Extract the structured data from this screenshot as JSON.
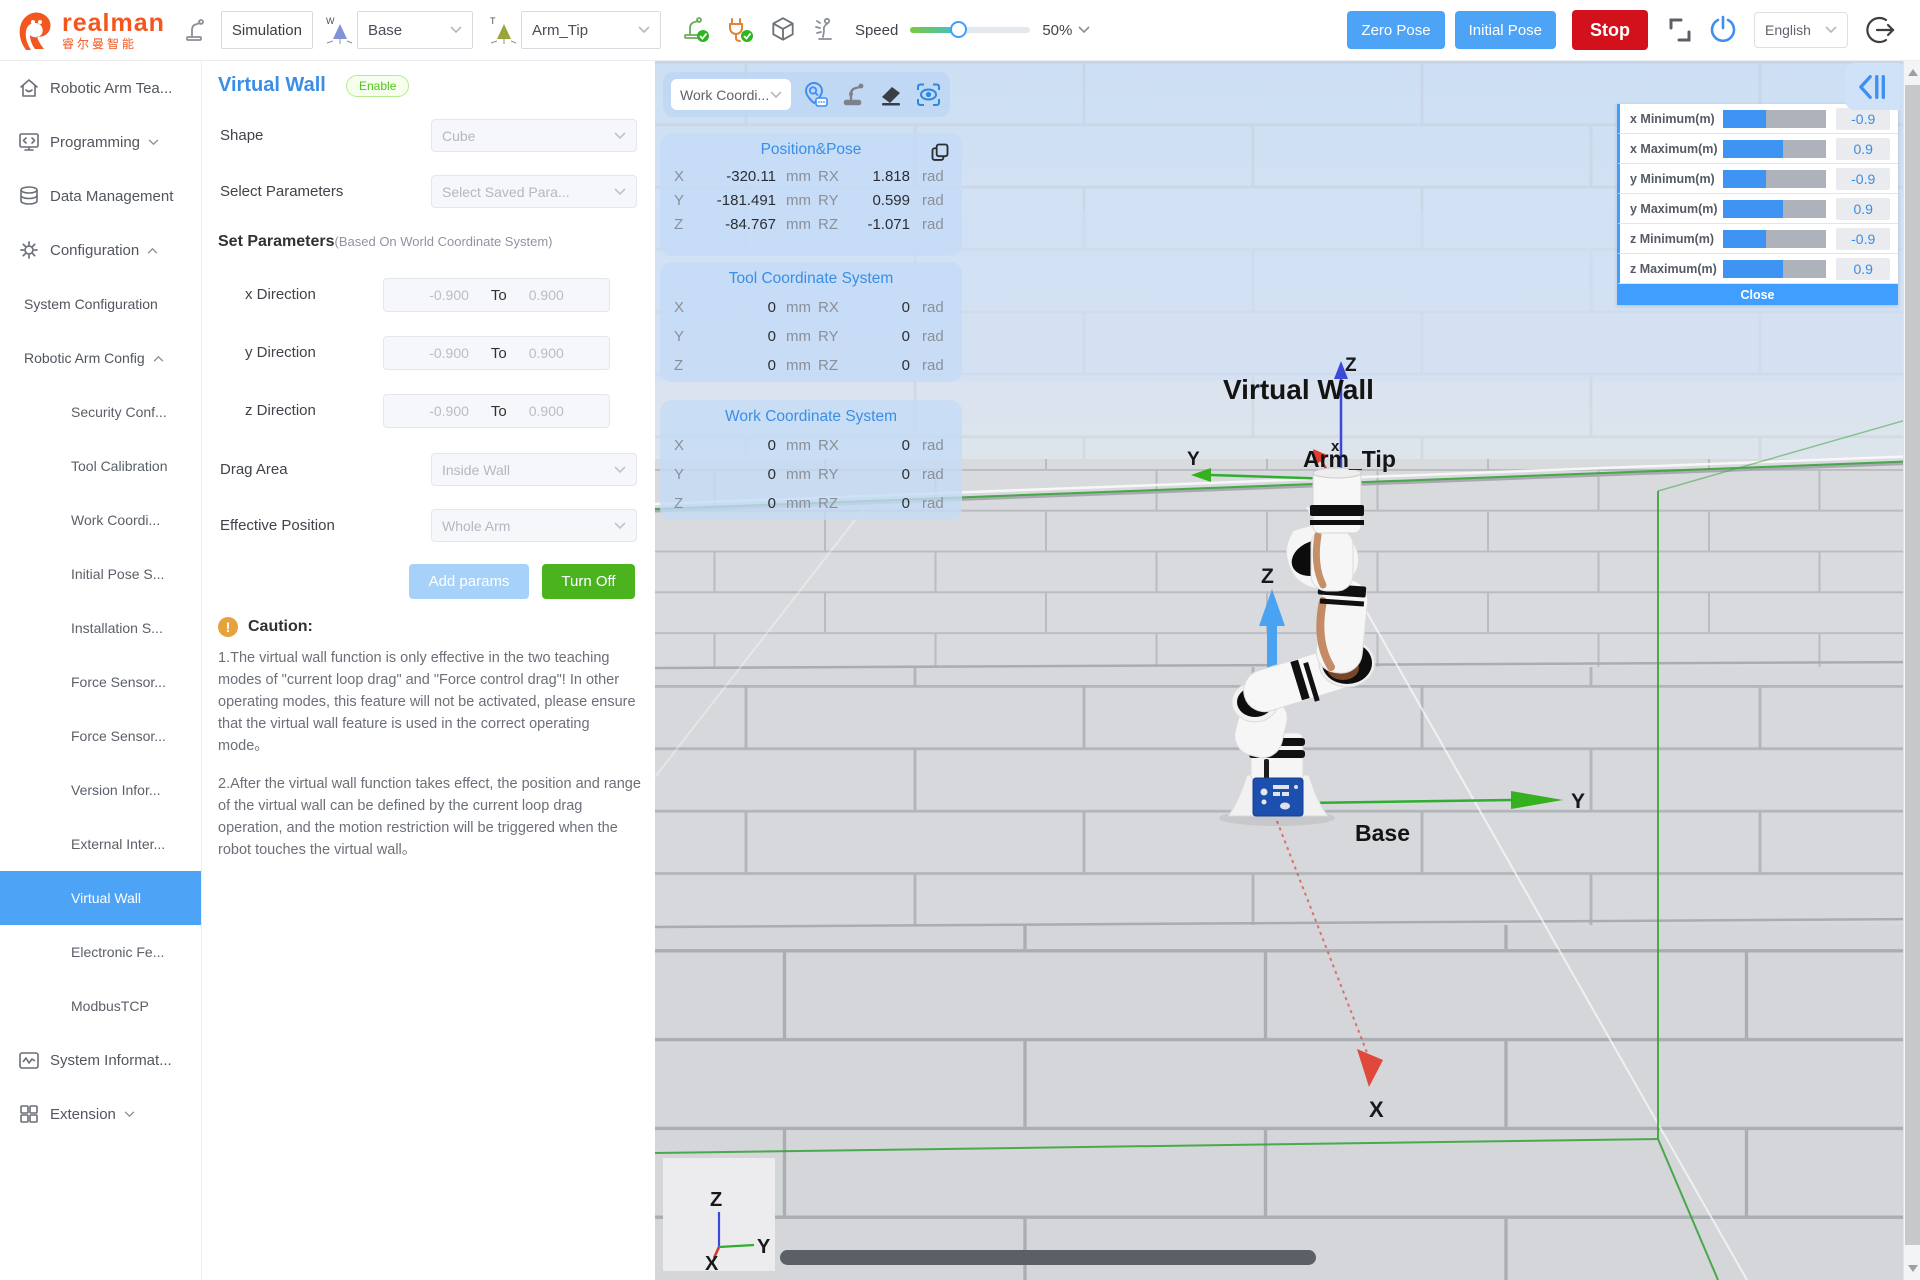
{
  "colors": {
    "accent": "#409eff",
    "button_blue": "#4da3f5",
    "stop_red": "#d3111c",
    "green": "#4bb31e",
    "badge_green": "#52c41a",
    "brand_orange": "#f3571f",
    "panel_blue": "rgba(196,219,246,0.8)"
  },
  "topbar": {
    "brand_name": "realman",
    "brand_cn": "睿尔曼智能",
    "mode_box": "Simulation",
    "world_label": "W",
    "world_value": "Base",
    "tool_label": "T",
    "tool_value": "Arm_Tip",
    "speed_label": "Speed",
    "speed_value": "50%",
    "zero_pose": "Zero Pose",
    "initial_pose": "Initial Pose",
    "stop": "Stop",
    "language": "English"
  },
  "sidebar": {
    "items": [
      {
        "label": "Robotic Arm Tea...",
        "level": 1
      },
      {
        "label": "Programming",
        "level": 1
      },
      {
        "label": "Data Management",
        "level": 1
      },
      {
        "label": "Configuration",
        "level": 1
      },
      {
        "label": "System Configuration",
        "level": 2
      },
      {
        "label": "Robotic Arm Config",
        "level": 2
      },
      {
        "label": "Security Conf...",
        "level": 3
      },
      {
        "label": "Tool Calibration",
        "level": 3
      },
      {
        "label": "Work Coordi...",
        "level": 3
      },
      {
        "label": "Initial Pose S...",
        "level": 3
      },
      {
        "label": "Installation S...",
        "level": 3
      },
      {
        "label": "Force Sensor...",
        "level": 3
      },
      {
        "label": "Force Sensor...",
        "level": 3
      },
      {
        "label": "Version Infor...",
        "level": 3
      },
      {
        "label": "External Inter...",
        "level": 3
      },
      {
        "label": "Virtual Wall",
        "level": 3,
        "selected": true
      },
      {
        "label": "Electronic Fe...",
        "level": 3
      },
      {
        "label": "ModbusTCP",
        "level": 3
      },
      {
        "label": "System Informat...",
        "level": 1
      },
      {
        "label": "Extension",
        "level": 1
      }
    ]
  },
  "form": {
    "title": "Virtual Wall",
    "badge": "Enable",
    "shape_label": "Shape",
    "shape_value": "Cube",
    "select_params_label": "Select Parameters",
    "select_params_value": "Select Saved Para...",
    "set_params_title": "Set Parameters",
    "set_params_note": "(Based On World Coordinate System)",
    "directions": [
      {
        "label": "x Direction",
        "min": "-0.900",
        "sep": "To",
        "max": "0.900"
      },
      {
        "label": "y Direction",
        "min": "-0.900",
        "sep": "To",
        "max": "0.900"
      },
      {
        "label": "z Direction",
        "min": "-0.900",
        "sep": "To",
        "max": "0.900"
      }
    ],
    "drag_area_label": "Drag Area",
    "drag_area_value": "Inside Wall",
    "effective_label": "Effective Position",
    "effective_value": "Whole Arm",
    "add_params": "Add params",
    "turn_off": "Turn Off",
    "caution_mark": "!",
    "caution_title": "Caution:",
    "caution_1": "1.The virtual wall function is only effective in the two teaching modes of \"current loop drag\" and \"Force control drag\"! In other operating modes, this feature will not be activated, please ensure that the virtual wall feature is used in the correct operating mode。",
    "caution_2": "2.After the virtual wall function takes effect, the position and range of the virtual wall can be defined by the current loop drag operation, and the motion restriction will be triggered when the robot touches the virtual wall。"
  },
  "viewport": {
    "frame_select": "Work Coordi...",
    "pose": {
      "title": "Position&Pose",
      "rows": [
        {
          "a": "X",
          "v": "-320.11",
          "u": "mm",
          "r": "RX",
          "rv": "1.818",
          "ru": "rad"
        },
        {
          "a": "Y",
          "v": "-181.491",
          "u": "mm",
          "r": "RY",
          "rv": "0.599",
          "ru": "rad"
        },
        {
          "a": "Z",
          "v": "-84.767",
          "u": "mm",
          "r": "RZ",
          "rv": "-1.071",
          "ru": "rad"
        }
      ]
    },
    "tool": {
      "title": "Tool Coordinate System",
      "rows": [
        {
          "a": "X",
          "v": "0",
          "u": "mm",
          "r": "RX",
          "rv": "0",
          "ru": "rad"
        },
        {
          "a": "Y",
          "v": "0",
          "u": "mm",
          "r": "RY",
          "rv": "0",
          "ru": "rad"
        },
        {
          "a": "Z",
          "v": "0",
          "u": "mm",
          "r": "RZ",
          "rv": "0",
          "ru": "rad"
        }
      ]
    },
    "work": {
      "title": "Work Coordinate System",
      "rows": [
        {
          "a": "X",
          "v": "0",
          "u": "mm",
          "r": "RX",
          "rv": "0",
          "ru": "rad"
        },
        {
          "a": "Y",
          "v": "0",
          "u": "mm",
          "r": "RY",
          "rv": "0",
          "ru": "rad"
        },
        {
          "a": "Z",
          "v": "0",
          "u": "mm",
          "r": "RZ",
          "rv": "0",
          "ru": "rad"
        }
      ]
    },
    "wall": {
      "rows": [
        {
          "label": "x Minimum(m)",
          "value": "-0.9",
          "fill": "41%"
        },
        {
          "label": "x Maximum(m)",
          "value": "0.9",
          "fill": "58%"
        },
        {
          "label": "y Minimum(m)",
          "value": "-0.9",
          "fill": "41%"
        },
        {
          "label": "y Maximum(m)",
          "value": "0.9",
          "fill": "58%"
        },
        {
          "label": "z Minimum(m)",
          "value": "-0.9",
          "fill": "41%"
        },
        {
          "label": "z Maximum(m)",
          "value": "0.9",
          "fill": "58%"
        }
      ],
      "close": "Close"
    },
    "scene": {
      "virtual_wall": "Virtual Wall",
      "arm_tip": "Arm_Tip",
      "base": "Base",
      "tip_z": "Z",
      "tip_y": "Y",
      "tip_x": "x",
      "mid_z": "Z",
      "base_y": "Y",
      "base_x": "X"
    },
    "gizmo": {
      "x": "X",
      "y": "Y",
      "z": "Z"
    }
  }
}
